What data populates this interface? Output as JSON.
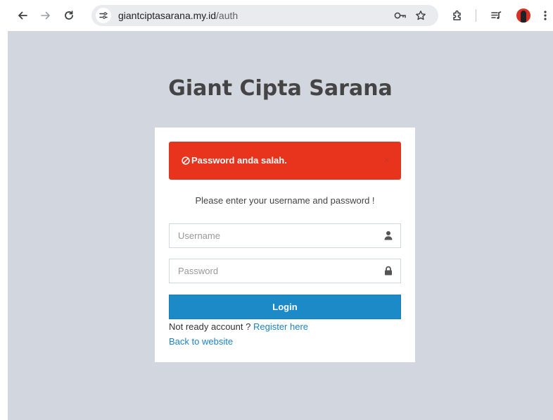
{
  "browser": {
    "url_host": "giantciptasarana.my.id",
    "url_path": "/auth",
    "icons": [
      "back-arrow-icon",
      "forward-arrow-icon",
      "reload-icon",
      "site-info-icon",
      "password-key-icon",
      "bookmark-star-icon",
      "extensions-icon",
      "media-control-icon",
      "profile-avatar",
      "more-menu-icon"
    ]
  },
  "page": {
    "logo": "Giant Cipta Sarana",
    "alert": {
      "text": "Password anda salah.",
      "close": "×",
      "color": "#e8341c"
    },
    "message": "Please enter your username and password !",
    "username": {
      "placeholder": "Username",
      "value": ""
    },
    "password": {
      "placeholder": "Password",
      "value": ""
    },
    "login_button": "Login",
    "register_prefix": "Not ready account ? ",
    "register_link": "Register here",
    "back_link": "Back to website",
    "colors": {
      "background": "#d2d6de",
      "primary": "#1c8ac6",
      "link": "#1c82c6",
      "danger": "#e8341c"
    }
  }
}
